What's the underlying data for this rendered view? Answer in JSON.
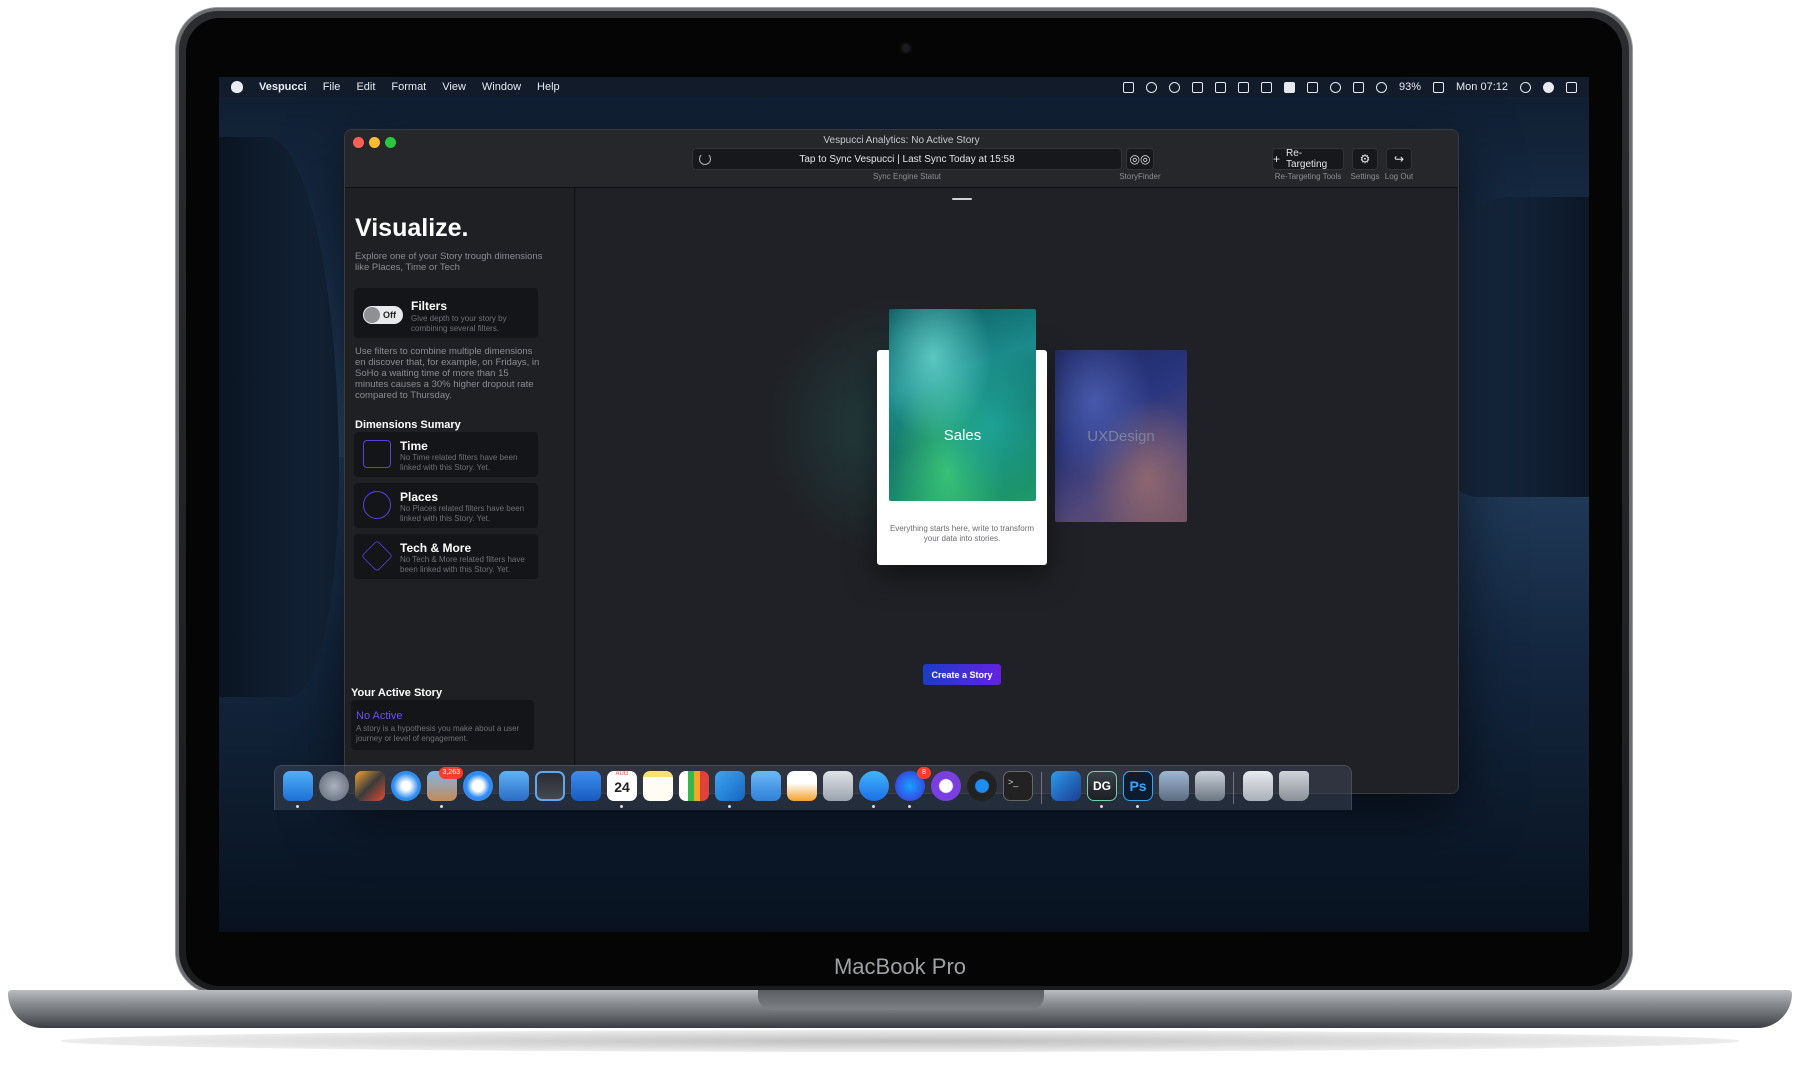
{
  "device": {
    "brand": "MacBook Pro"
  },
  "menubar": {
    "items": [
      "Vespucci",
      "File",
      "Edit",
      "Format",
      "View",
      "Window",
      "Help"
    ],
    "battery": "93%",
    "clock": "Mon 07:12"
  },
  "window": {
    "title": "Vespucci Analytics: No Active Story",
    "sync_text": "Tap to Sync Vespucci | Last Sync Today at 15:58",
    "sync_caption": "Sync Engine Statut",
    "storyfinder_caption": "StoryFinder",
    "retargeting_label": "Re-Targeting",
    "retargeting_caption": "Re-Targeting Tools",
    "settings_caption": "Settings",
    "logout_caption": "Log Out"
  },
  "sidebar": {
    "title": "Visualize.",
    "subtitle": "Explore one of your Story trough dimensions like Places, Time or Tech",
    "filters": {
      "toggle_label": "Off",
      "title": "Filters",
      "desc": "Give depth to your story by combining several filters.",
      "long_desc": "Use filters to combine multiple dimensions en discover that, for example, on Fridays, in SoHo a waiting time of more than 15 minutes causes a 30% higher dropout rate compared to Thursday."
    },
    "dimensions_title": "Dimensions Sumary",
    "dimensions": [
      {
        "title": "Time",
        "desc": "No Time related filters have been linked with this Story. Yet.",
        "icon": "calendar-icon"
      },
      {
        "title": "Places",
        "desc": "No Places related filters have been linked with this Story. Yet.",
        "icon": "target-icon"
      },
      {
        "title": "Tech & More",
        "desc": "No Tech & More related filters have been linked with this Story. Yet.",
        "icon": "cube-icon"
      }
    ],
    "active_story_title": "Your Active Story",
    "active_story": {
      "title": "No Active",
      "desc": "A story is a hypothesis you make about a user journey or level of engagement."
    }
  },
  "main": {
    "cards": [
      {
        "label": "Sales",
        "desc": "Everything starts here, write to transform your data into stories."
      },
      {
        "label": "UXDesign"
      }
    ],
    "create_button": "Create a Story"
  },
  "dock": {
    "mail_badge": "3,263",
    "messenger_badge": "8",
    "calendar_month": "AUG",
    "calendar_day": "24",
    "ps_label": "Ps",
    "dg_label": "DG"
  }
}
